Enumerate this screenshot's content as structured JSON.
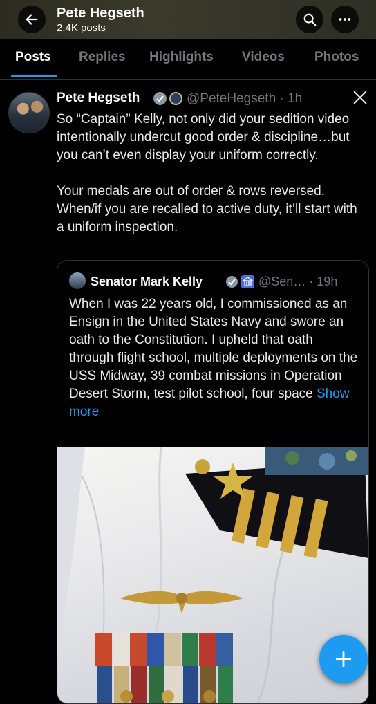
{
  "header": {
    "title": "Pete Hegseth",
    "subtitle": "2.4K posts"
  },
  "tabs": [
    {
      "label": "Posts"
    },
    {
      "label": "Replies"
    },
    {
      "label": "Highlights"
    },
    {
      "label": "Videos"
    },
    {
      "label": "Photos"
    }
  ],
  "post": {
    "author_name": "Pete Hegseth",
    "handle_time": "@PeteHegseth · 1h",
    "text": "So “Captain” Kelly, not only did your sedition video intentionally undercut good order & discipline…but you can’t even display your uniform correctly.\n\nYour medals are out of order & rows reversed. When/if you are recalled to active duty, it’ll start with a uniform inspection."
  },
  "quote": {
    "author_name": "Senator Mark Kelly",
    "handle_time": "@Sen… · 19h",
    "text": "When I was 22 years old, I commissioned as an Ensign in the United States Navy and swore an oath to the Constitution. I upheld that oath through flight school, multiple deployments on the USS Midway, 39 combat missions in Operation Desert Storm, test pilot school, four space ",
    "show_more": "Show more"
  },
  "colors": {
    "accent": "#1d9bf0",
    "background": "#000000",
    "muted": "#71767b"
  }
}
